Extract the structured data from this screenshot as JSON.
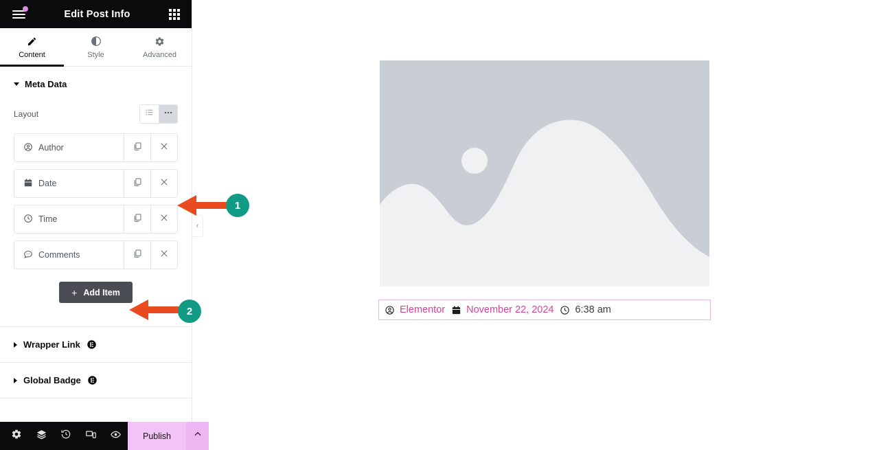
{
  "panel": {
    "header": {
      "title": "Edit Post Info",
      "menu_icon": "hamburger-menu-icon",
      "widgets_icon": "widgets-grid-icon"
    },
    "tabs": [
      {
        "label": "Content",
        "icon": "pencil-icon",
        "active": true
      },
      {
        "label": "Style",
        "icon": "contrast-circle-icon",
        "active": false
      },
      {
        "label": "Advanced",
        "icon": "gear-icon",
        "active": false
      }
    ],
    "section": {
      "title": "Meta Data",
      "expanded": true,
      "layout_control": {
        "label": "Layout",
        "options": [
          {
            "name": "stacked",
            "icon": "list-icon",
            "selected": false
          },
          {
            "name": "inline",
            "icon": "dots-horizontal-icon",
            "selected": true
          }
        ]
      },
      "items": [
        {
          "label": "Author",
          "icon": "user-circle-icon",
          "duplicate_icon": "copy-icon",
          "remove_icon": "close-icon"
        },
        {
          "label": "Date",
          "icon": "calendar-icon",
          "duplicate_icon": "copy-icon",
          "remove_icon": "close-icon"
        },
        {
          "label": "Time",
          "icon": "clock-icon",
          "duplicate_icon": "copy-icon",
          "remove_icon": "close-icon"
        },
        {
          "label": "Comments",
          "icon": "comment-bubble-icon",
          "duplicate_icon": "copy-icon",
          "remove_icon": "close-icon"
        }
      ],
      "add_item_label": "Add Item",
      "add_item_plus": "+"
    },
    "collapsed_sections": [
      {
        "title": "Wrapper Link",
        "pro_icon": "elementor-pro-badge-icon"
      },
      {
        "title": "Global Badge",
        "pro_icon": "elementor-pro-badge-icon"
      }
    ],
    "footer": {
      "tools": [
        {
          "name": "settings-icon"
        },
        {
          "name": "navigator-layers-icon"
        },
        {
          "name": "history-icon"
        },
        {
          "name": "responsive-mode-icon"
        },
        {
          "name": "preview-eye-icon"
        }
      ],
      "publish_label": "Publish",
      "publish_caret_icon": "chevron-up-icon"
    },
    "collapse_handle_icon": "chevron-left-icon"
  },
  "canvas": {
    "placeholder_image": {
      "name": "image-placeholder",
      "bg_color": "#c9ced4",
      "shape_color": "#eff1f3"
    },
    "meta_bar": {
      "border_color": "#e9b8e0",
      "items": [
        {
          "icon": "user-circle-icon",
          "text": "Elementor",
          "color": "#d6439a",
          "is_link": true
        },
        {
          "icon": "calendar-icon",
          "text": "November 22, 2024",
          "color": "#d6439a",
          "is_link": true
        },
        {
          "icon": "clock-icon",
          "text": "6:38 am",
          "color": "#3b3b42",
          "is_link": false
        }
      ]
    }
  },
  "annotations": {
    "arrow_color": "#ea4a20",
    "badge_color": "#119b84",
    "markers": [
      {
        "number": "1",
        "points_to": "date-item-remove-button"
      },
      {
        "number": "2",
        "points_to": "add-item-button"
      }
    ]
  }
}
